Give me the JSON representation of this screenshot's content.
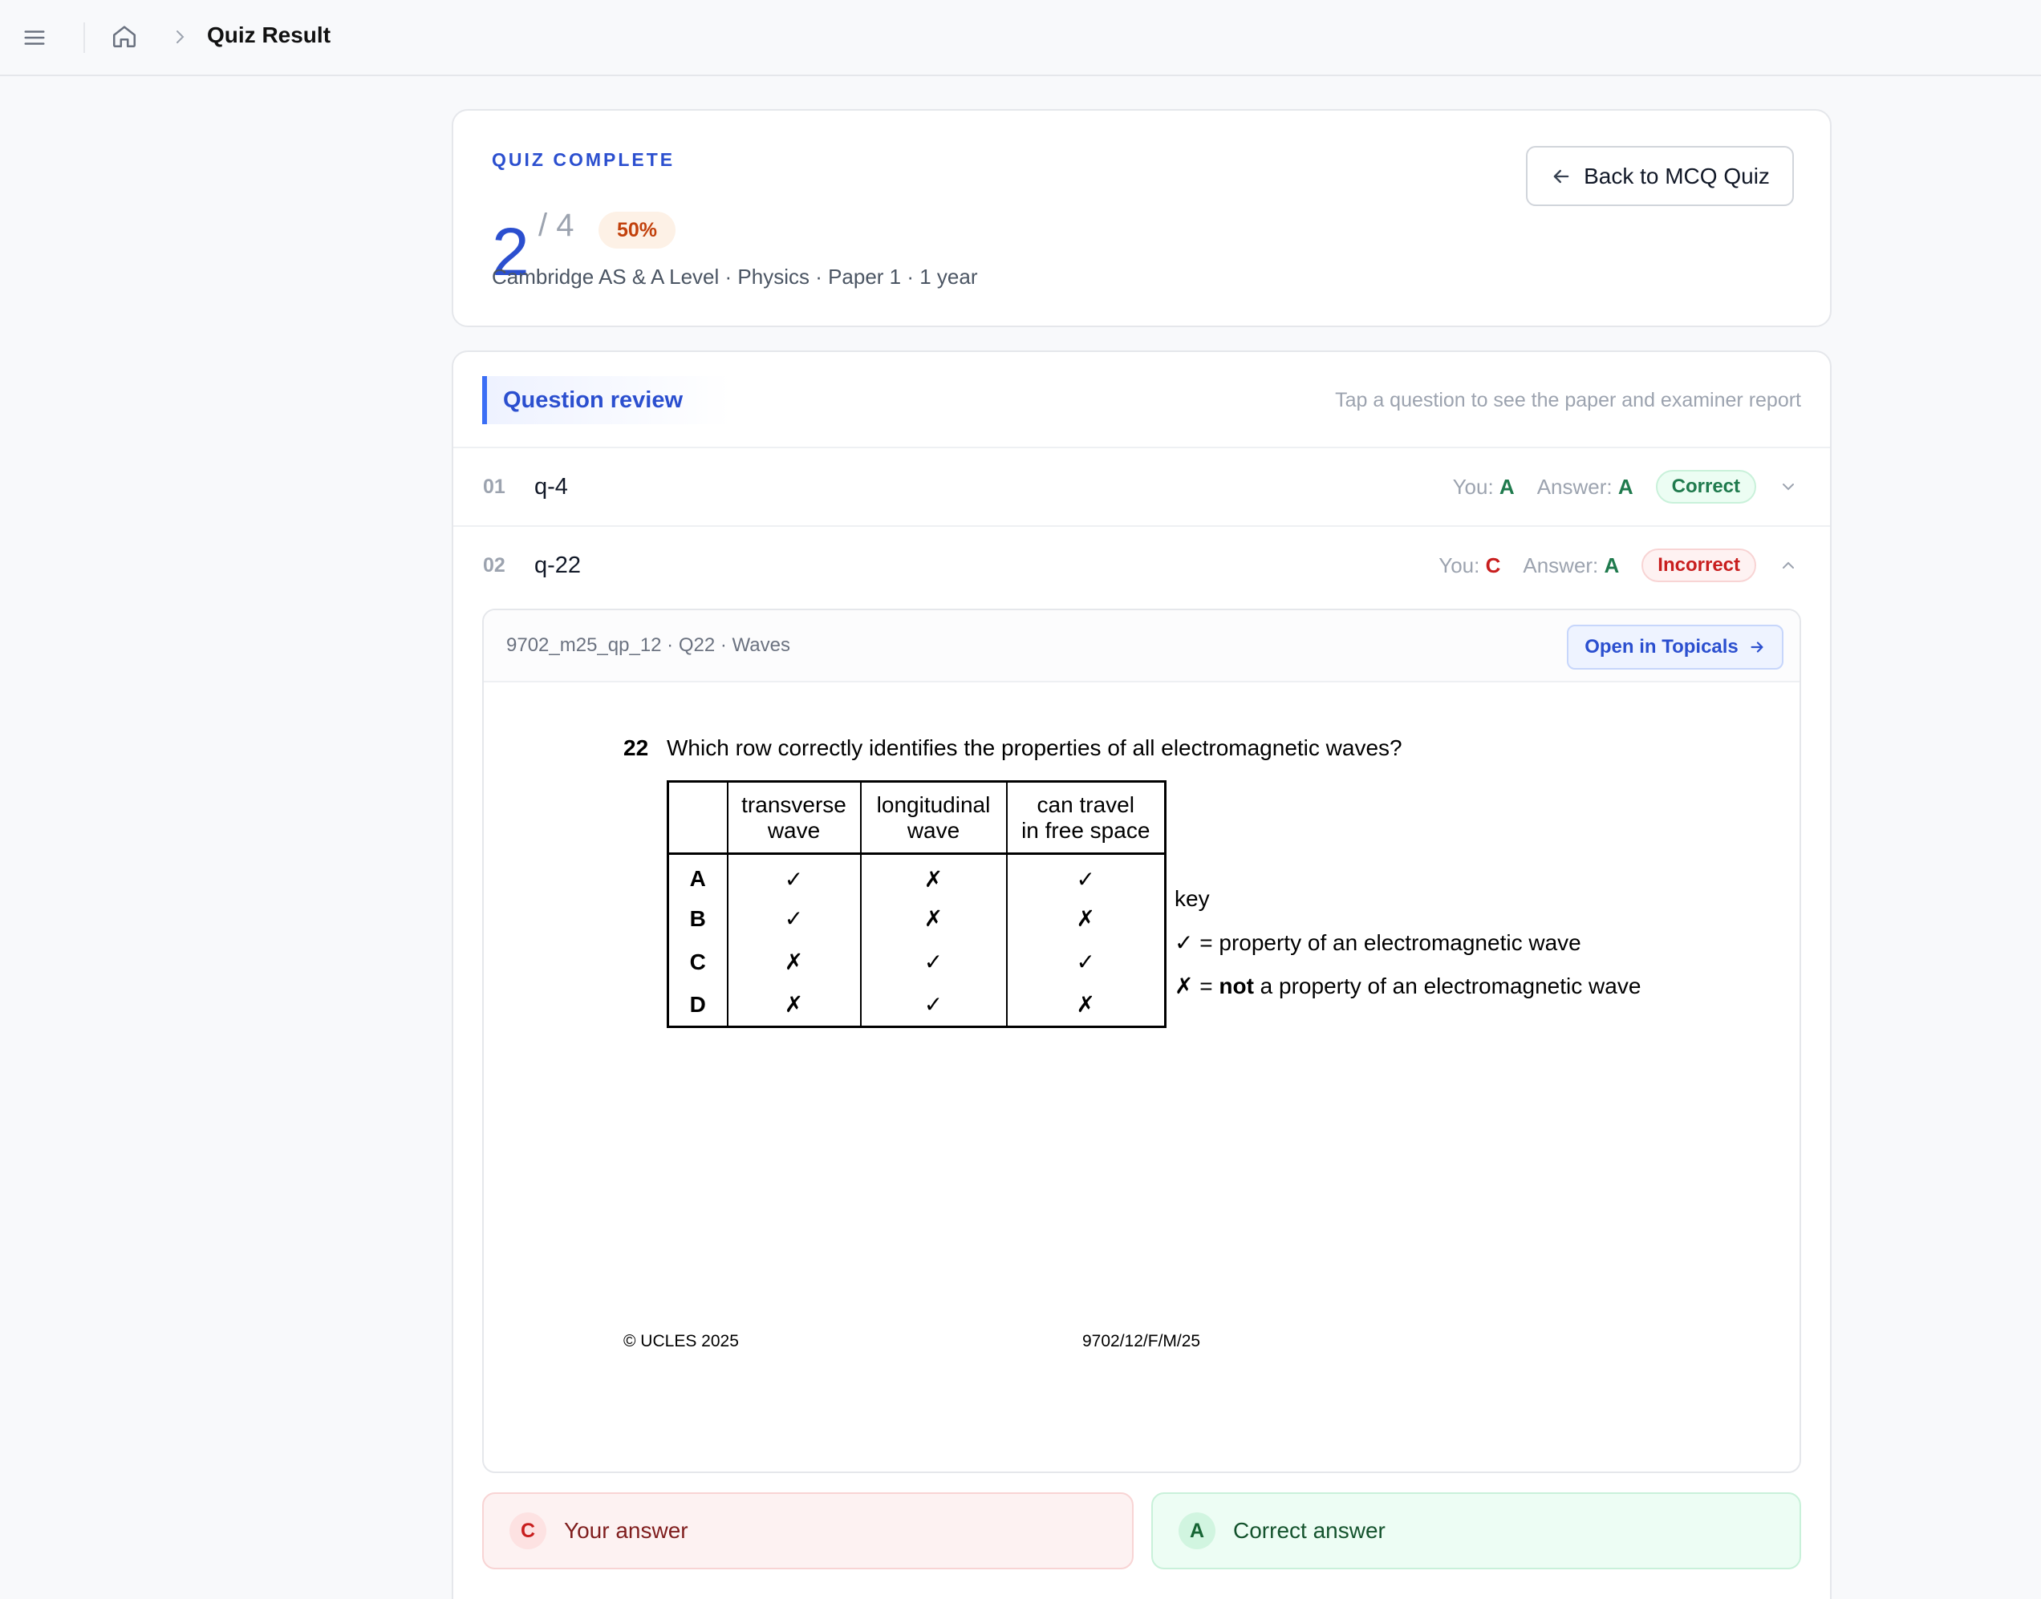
{
  "header": {
    "breadcrumb_current": "Quiz Result"
  },
  "summary": {
    "label": "QUIZ COMPLETE",
    "score": "2",
    "total": "/ 4",
    "percent_label": "50%",
    "meta": "Cambridge AS & A Level · Physics · Paper 1 · 1 year",
    "back_button": "Back to MCQ Quiz"
  },
  "review": {
    "title": "Question review",
    "hint": "Tap a question to see the paper and examiner report",
    "questions": [
      {
        "num": "01",
        "id": "q-4",
        "you_label": "You:",
        "you": "A",
        "answer_label": "Answer:",
        "answer": "A",
        "status": "Correct",
        "expanded": false
      },
      {
        "num": "02",
        "id": "q-22",
        "you_label": "You:",
        "you": "C",
        "answer_label": "Answer:",
        "answer": "A",
        "status": "Incorrect",
        "expanded": true
      }
    ],
    "detail": {
      "ref": "9702_m25_qp_12 · Q22 · Waves",
      "open_button": "Open in Topicals",
      "paper": {
        "qnum": "22",
        "question": "Which row correctly identifies the properties of all electromagnetic waves?",
        "headers": [
          "transverse wave",
          "longitudinal wave",
          "can travel in free space"
        ],
        "header_lines": [
          [
            "transverse",
            "wave"
          ],
          [
            "longitudinal",
            "wave"
          ],
          [
            "can travel",
            "in free space"
          ]
        ],
        "rows": [
          {
            "label": "A",
            "cells": [
              "✓",
              "✗",
              "✓"
            ]
          },
          {
            "label": "B",
            "cells": [
              "✓",
              "✗",
              "✗"
            ]
          },
          {
            "label": "C",
            "cells": [
              "✗",
              "✓",
              "✓"
            ]
          },
          {
            "label": "D",
            "cells": [
              "✗",
              "✓",
              "✗"
            ]
          }
        ],
        "key_title": "key",
        "key_tick": "✓ = property of an electromagnetic wave",
        "key_cross_prefix": "✗ = ",
        "key_cross_bold": "not",
        "key_cross_rest": " a property of an electromagnetic wave",
        "copyright": "© UCLES 2025",
        "code": "9702/12/F/M/25"
      },
      "your_answer": {
        "letter": "C",
        "label": "Your answer"
      },
      "correct_answer": {
        "letter": "A",
        "label": "Correct answer"
      }
    }
  },
  "colors": {
    "brand": "#2b4fcf",
    "correct": "#1f7a4d",
    "incorrect": "#c81e1e"
  }
}
